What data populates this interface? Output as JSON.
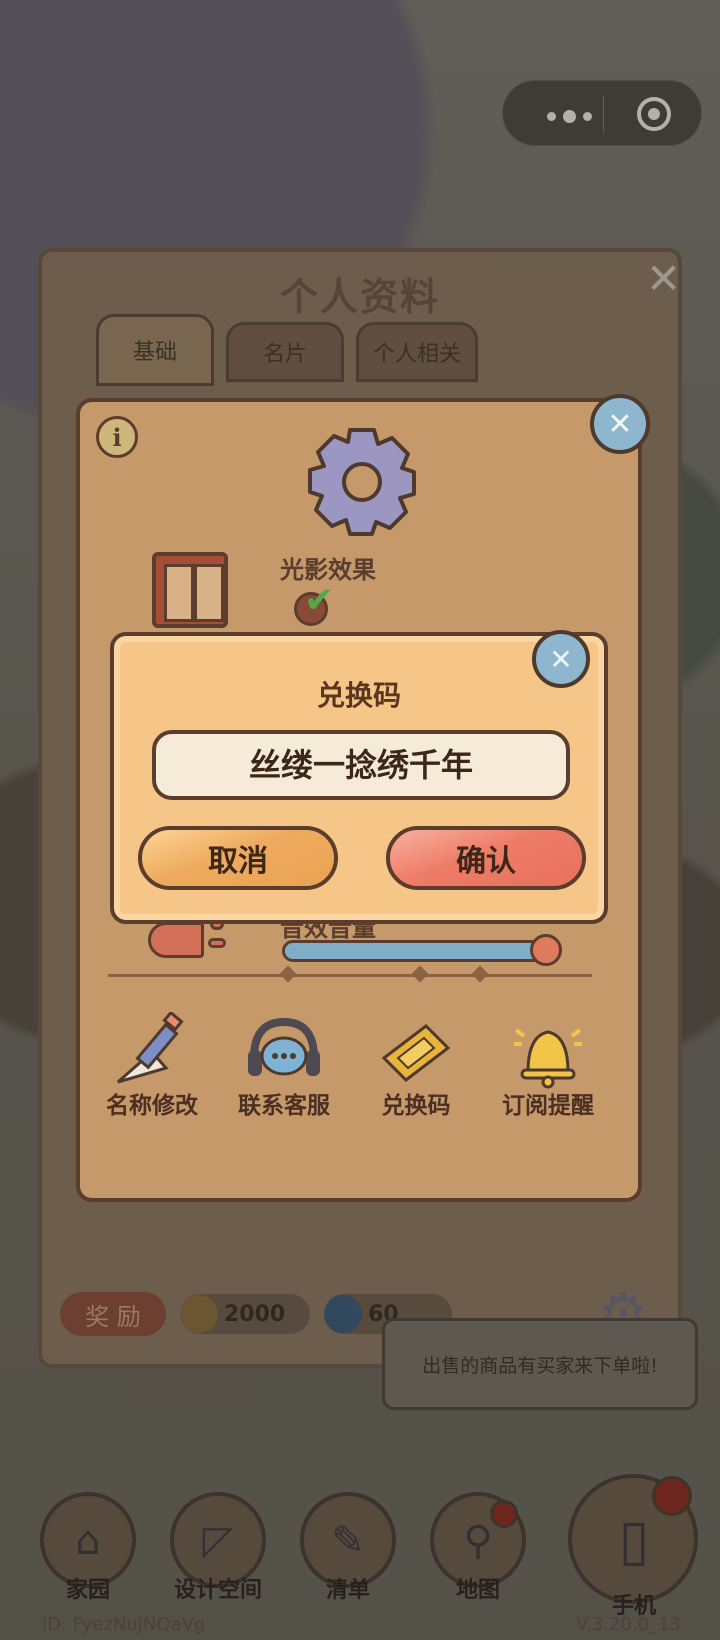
{
  "top_capsule": {
    "more_icon": "more-dots-icon",
    "close_icon": "target-close-icon"
  },
  "profile": {
    "title": "个人资料",
    "tabs": [
      {
        "label": "基础",
        "active": true
      },
      {
        "label": "名片",
        "active": false
      },
      {
        "label": "个人相关",
        "active": false
      }
    ],
    "reward_label": "奖 励",
    "coins": "2000",
    "gems": "60"
  },
  "settings": {
    "shadow_label": "光影效果",
    "shadow_enabled": true,
    "sound_label": "音效音量",
    "sound_level": 0.95,
    "shortcuts": [
      {
        "label": "名称修改",
        "icon": "pencil-icon"
      },
      {
        "label": "联系客服",
        "icon": "headset-icon"
      },
      {
        "label": "兑换码",
        "icon": "ticket-icon"
      },
      {
        "label": "订阅提醒",
        "icon": "bell-icon"
      }
    ]
  },
  "redeem": {
    "title": "兑换码",
    "code_value": "丝缕一捻绣千年",
    "cancel_label": "取消",
    "confirm_label": "确认"
  },
  "bubble_text": "出售的商品有买家来下单啦!",
  "nav": [
    {
      "label": "家园",
      "icon": "house-icon"
    },
    {
      "label": "设计空间",
      "icon": "ruler-icon"
    },
    {
      "label": "清单",
      "icon": "list-icon"
    },
    {
      "label": "地图",
      "icon": "map-pin-icon"
    },
    {
      "label": "手机",
      "icon": "phone-icon"
    }
  ],
  "footer": {
    "id_text": "ID: FyezNuJNQaVg",
    "version": "V.3.20.0_13"
  },
  "colors": {
    "dialog_bg": "#c6996b",
    "redeem_bg": "#f6c688",
    "cancel": "#eeaa5e",
    "confirm": "#ee7c67",
    "outline": "#5a3d2c"
  }
}
